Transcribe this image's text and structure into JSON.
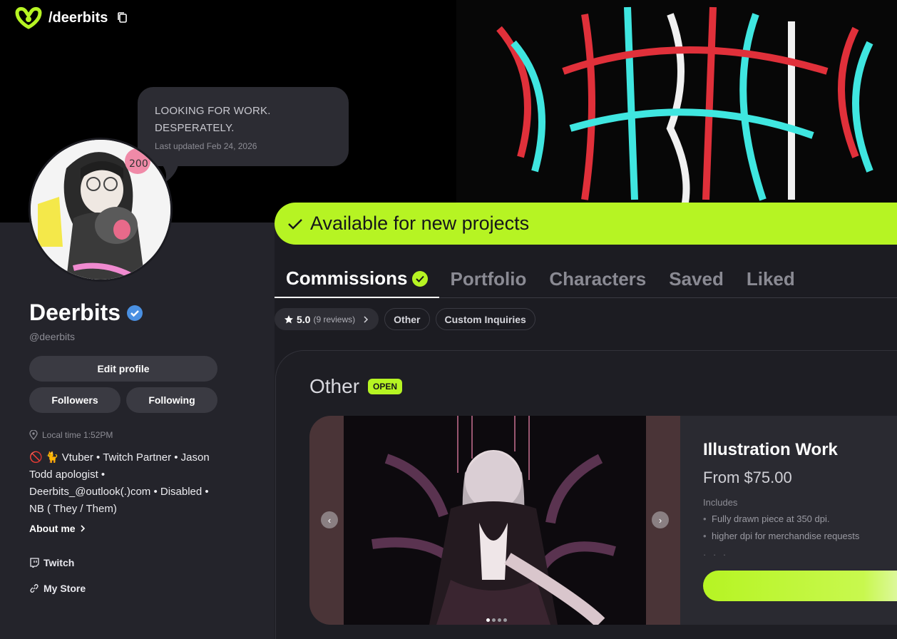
{
  "brand": {
    "handle_path": "/deerbits"
  },
  "status_bubble": {
    "line1": "LOOKING FOR WORK.",
    "line2": "DESPERATELY.",
    "updated": "Last updated Feb 24, 2026"
  },
  "profile": {
    "name": "Deerbits",
    "handle": "@deerbits",
    "edit_label": "Edit profile",
    "followers_label": "Followers",
    "following_label": "Following",
    "local_time": "Local time 1:52PM",
    "bio": "🚫 🐈 Vtuber • Twitch Partner • Jason Todd apologist • Deerbits_@outlook(.)com • Disabled • NB ( They / Them)",
    "about_label": "About me",
    "links": {
      "twitch": "Twitch",
      "store": "My Store"
    }
  },
  "availability": "Available for new projects",
  "tabs": [
    "Commissions",
    "Portfolio",
    "Characters",
    "Saved",
    "Liked"
  ],
  "chips": {
    "rating": "5.0",
    "reviews": "(9 reviews)",
    "other": "Other",
    "custom": "Custom Inquiries"
  },
  "section": {
    "title": "Other",
    "badge": "OPEN"
  },
  "card": {
    "title": "Illustration Work",
    "price": "From $75.00",
    "includes_label": "Includes",
    "includes": [
      "Fully drawn piece at 350 dpi.",
      "higher dpi for merchandise requests"
    ],
    "more": "· · ·"
  },
  "colors": {
    "accent": "#b6f423",
    "background": "#1c1c22",
    "sidebar": "#24242b"
  }
}
